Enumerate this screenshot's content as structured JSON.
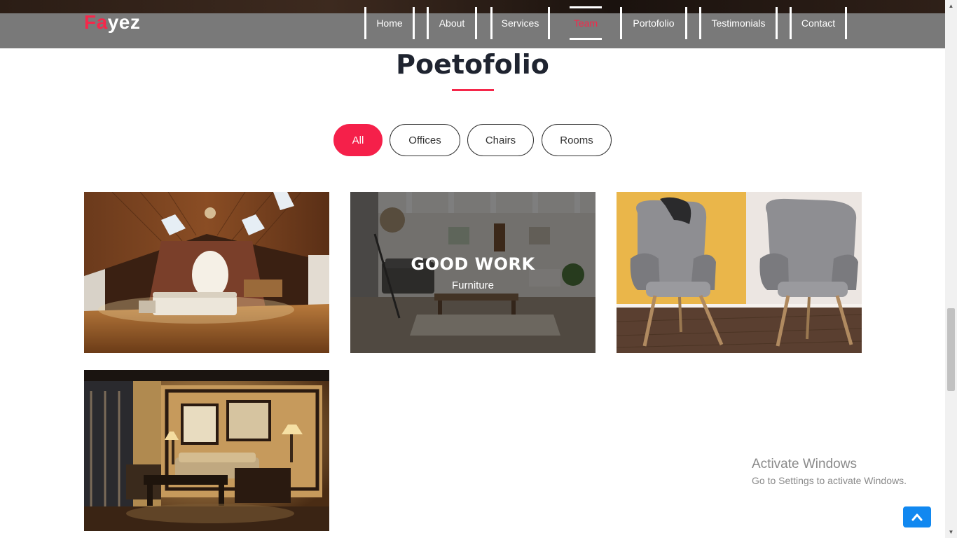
{
  "brand": {
    "accent": "Fa",
    "rest": "yez",
    "accent_color": "#f5274a"
  },
  "nav": {
    "items": [
      {
        "label": "Home"
      },
      {
        "label": "About"
      },
      {
        "label": "Services"
      },
      {
        "label": "Team",
        "active": true
      },
      {
        "label": "Portofolio"
      },
      {
        "label": "Testimonials"
      },
      {
        "label": "Contact"
      }
    ]
  },
  "portfolio": {
    "title": "Poetofolio",
    "filters": [
      {
        "label": "All",
        "active": true
      },
      {
        "label": "Offices"
      },
      {
        "label": "Chairs"
      },
      {
        "label": "Rooms"
      }
    ],
    "hover_card": {
      "title": "GOOD WORK",
      "subtitle": "Furniture"
    }
  },
  "watermark": {
    "line1": "Activate Windows",
    "line2": "Go to Settings to activate Windows."
  },
  "icons": {
    "scroll_top": "chevron-up-icon"
  }
}
